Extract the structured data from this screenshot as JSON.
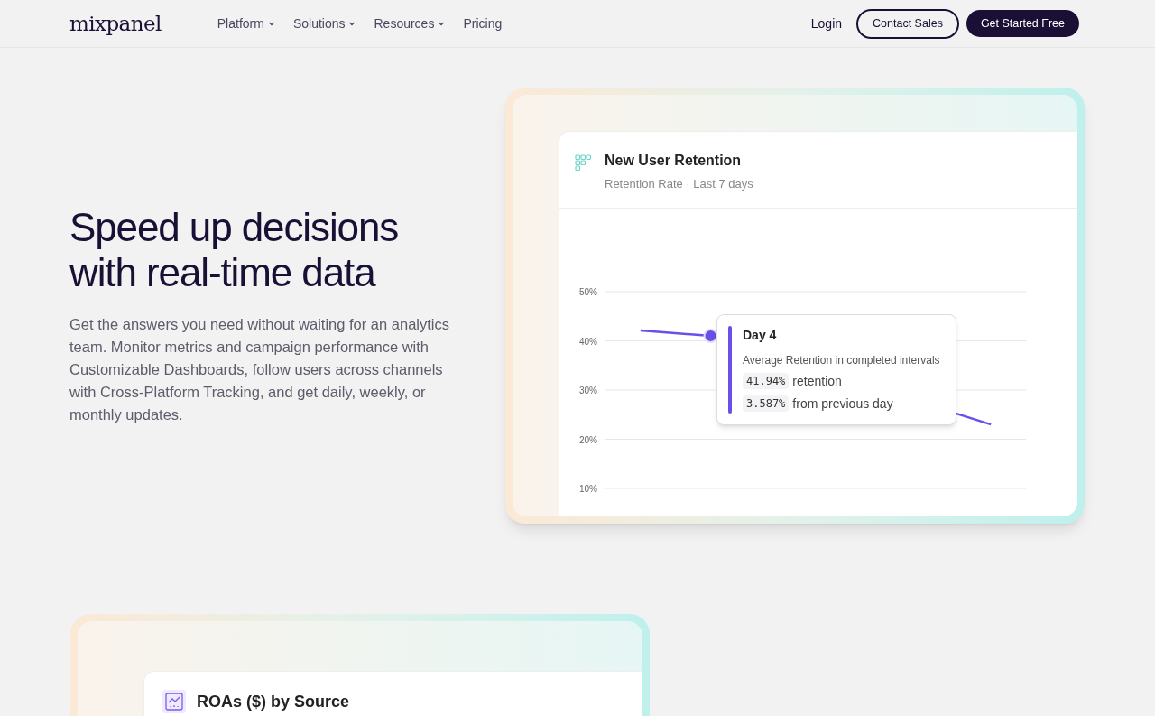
{
  "nav": {
    "logo": "mixpanel",
    "links": [
      {
        "label": "Platform",
        "dropdown": true
      },
      {
        "label": "Solutions",
        "dropdown": true
      },
      {
        "label": "Resources",
        "dropdown": true
      },
      {
        "label": "Pricing",
        "dropdown": false
      }
    ],
    "login": "Login",
    "contact": "Contact Sales",
    "cta": "Get Started Free"
  },
  "hero": {
    "heading": "Speed up decisions with real-time data",
    "body": "Get the answers you need without waiting for an analytics team. Monitor metrics and campaign performance with Customizable Dashboards, follow users across channels with Cross-Platform Tracking, and get daily, weekly, or monthly updates."
  },
  "retention_card": {
    "title": "New User Retention",
    "subtitle": "Retention Rate · Last 7 days",
    "chart_data": {
      "type": "line",
      "grid": true,
      "ylim": [
        10,
        50
      ],
      "yticks": [
        {
          "value": 10,
          "label": "10%"
        },
        {
          "value": 20,
          "label": "20%"
        },
        {
          "value": 30,
          "label": "30%"
        },
        {
          "value": 40,
          "label": "40%"
        },
        {
          "value": 50,
          "label": "50%"
        }
      ],
      "series": [
        {
          "color": "#6b4eea",
          "values": [
            42.1,
            41.0,
            null,
            null,
            null,
            23.0
          ]
        }
      ]
    },
    "tooltip": {
      "title": "Day 4",
      "description": "Average Retention in completed intervals",
      "rows": [
        {
          "value": "41.94%",
          "label": "retention"
        },
        {
          "value": "3.587%",
          "label": "from previous day"
        }
      ]
    }
  },
  "roas_card": {
    "title": "ROAs ($) by Source"
  }
}
